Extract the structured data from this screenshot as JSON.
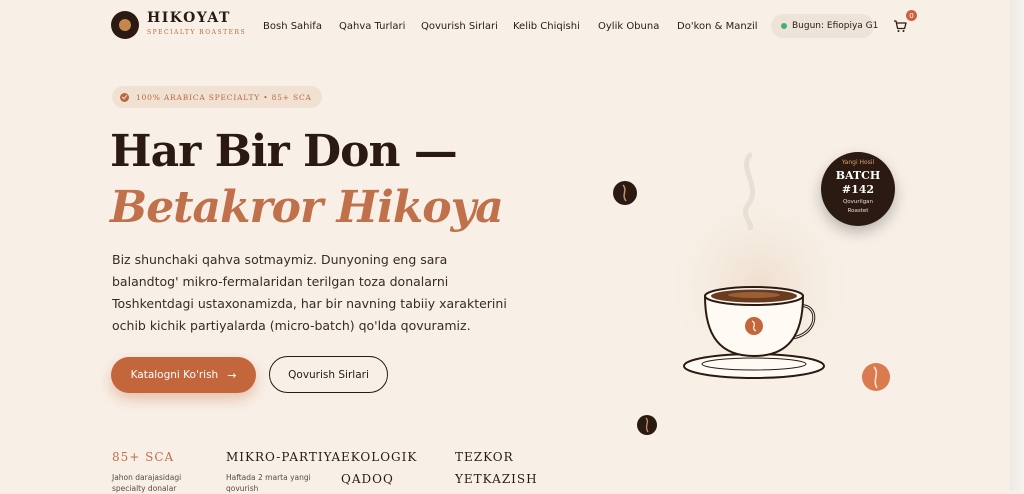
{
  "brand": {
    "name": "HIKOYAT",
    "tagline": "SPECIALTY ROASTERS"
  },
  "nav": {
    "items": [
      {
        "label": "Bosh Sahifa"
      },
      {
        "label": "Qahva Turlari"
      },
      {
        "label": "Qovurish Sirlari"
      },
      {
        "label": "Kelib Chiqishi"
      },
      {
        "label": "Oylik Obuna"
      },
      {
        "label": "Do'kon & Manzil"
      }
    ],
    "today": "Bugun: Efiopiya G1",
    "cart_count": "0"
  },
  "hero": {
    "badge": "100% ARABICA SPECIALTY • 85+ SCA",
    "title_line1": "Har Bir Don —",
    "title_line2": "Betakror Hikoya",
    "paragraph_lines": [
      "Biz shunchaki qahva sotmaymiz. Dunyoning eng sara",
      "balandtog' mikro-fermalaridan terilgan toza donalarni",
      "Toshkentdagi ustaxonamizda, har bir navning tabiiy xarakterini",
      "ochib kichik partiyalarda (micro-batch) qo'lda qovuramiz."
    ],
    "primary_button": "Katalogni Ko'rish",
    "secondary_button": "Qovurish Sirlari"
  },
  "batch_badge": {
    "top": "Yangi Hosil",
    "line1": "BATCH",
    "line2": "#142",
    "bottom_line1": "Qovurilgan",
    "bottom_line2": "Roastet"
  },
  "stats": [
    {
      "title": "85+ SCA",
      "sub_lines": [
        "Jahon darajasidagi",
        "specialty donalar"
      ]
    },
    {
      "title": "MIKRO-PARTIYA",
      "sub_lines": [
        "Haftada 2 marta yangi",
        "qovurish"
      ]
    },
    {
      "title": "EKOLOGIK",
      "title2": "QADOQ",
      "sub_lines": []
    },
    {
      "title": "TEZKOR",
      "title2": "YETKAZISH",
      "sub_lines": []
    }
  ],
  "colors": {
    "background": "#f8f0e7",
    "accent": "#c4663b",
    "dark": "#2a1a12",
    "status_green": "#3fb26f"
  }
}
